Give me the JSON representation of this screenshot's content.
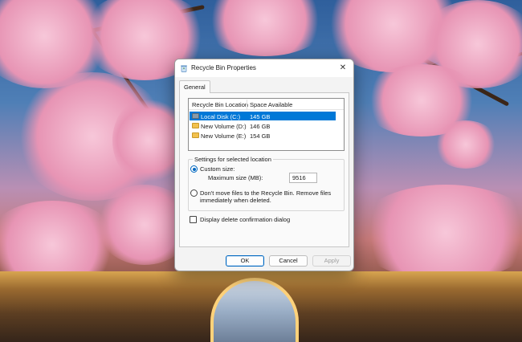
{
  "dialog": {
    "title": "Recycle Bin Properties",
    "close_glyph": "✕",
    "tab": "General",
    "list": {
      "col_location": "Recycle Bin Location",
      "col_space": "Space Available",
      "rows": [
        {
          "name": "Local Disk (C:)",
          "space": "145 GB",
          "selected": true,
          "icon": "drive-icon"
        },
        {
          "name": "New Volume (D:)",
          "space": "146 GB",
          "selected": false,
          "icon": "folder-drive-icon"
        },
        {
          "name": "New Volume (E:)",
          "space": "154 GB",
          "selected": false,
          "icon": "folder-drive-icon"
        }
      ]
    },
    "settings": {
      "group_label": "Settings for selected location",
      "custom_size_label": "Custom size:",
      "max_size_label": "Maximum size (MB):",
      "max_size_value": "9516",
      "dont_move_label_line1": "Don't move files to the Recycle Bin. Remove files",
      "dont_move_label_line2": "immediately when deleted.",
      "selected_option": "custom_size"
    },
    "confirm_checkbox_label": "Display delete confirmation dialog",
    "confirm_checked": false,
    "buttons": {
      "ok": "OK",
      "cancel": "Cancel",
      "apply": "Apply"
    }
  },
  "colors": {
    "selection": "#0078d7",
    "accent": "#0067c0",
    "folder": "#f2c14e"
  }
}
